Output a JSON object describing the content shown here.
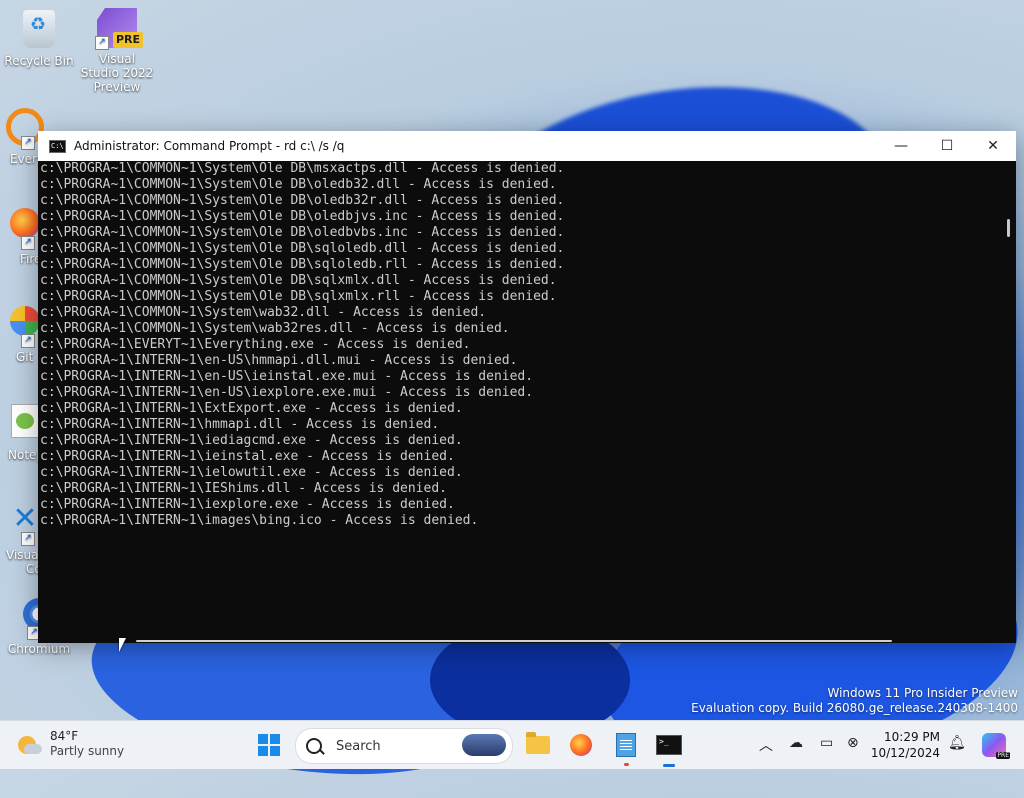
{
  "desktop": {
    "icons": [
      {
        "label": "Recycle Bin"
      },
      {
        "label": "Visual Studio 2022 Preview",
        "badge": "PRE"
      },
      {
        "label": "Every"
      },
      {
        "label": "Fire"
      },
      {
        "label": "Git"
      },
      {
        "label": "Notep"
      },
      {
        "label": "Visual"
      },
      {
        "label": "Co"
      },
      {
        "label": "Chromium"
      }
    ]
  },
  "window": {
    "title": "Administrator: Command Prompt - rd  c:\\ /s /q",
    "controls": {
      "minimize": "—",
      "maximize": "☐",
      "close": "✕"
    },
    "lines": [
      "c:\\PROGRA~1\\COMMON~1\\System\\Ole DB\\msxactps.dll - Access is denied.",
      "c:\\PROGRA~1\\COMMON~1\\System\\Ole DB\\oledb32.dll - Access is denied.",
      "c:\\PROGRA~1\\COMMON~1\\System\\Ole DB\\oledb32r.dll - Access is denied.",
      "c:\\PROGRA~1\\COMMON~1\\System\\Ole DB\\oledbjvs.inc - Access is denied.",
      "c:\\PROGRA~1\\COMMON~1\\System\\Ole DB\\oledbvbs.inc - Access is denied.",
      "c:\\PROGRA~1\\COMMON~1\\System\\Ole DB\\sqloledb.dll - Access is denied.",
      "c:\\PROGRA~1\\COMMON~1\\System\\Ole DB\\sqloledb.rll - Access is denied.",
      "c:\\PROGRA~1\\COMMON~1\\System\\Ole DB\\sqlxmlx.dll - Access is denied.",
      "c:\\PROGRA~1\\COMMON~1\\System\\Ole DB\\sqlxmlx.rll - Access is denied.",
      "c:\\PROGRA~1\\COMMON~1\\System\\wab32.dll - Access is denied.",
      "c:\\PROGRA~1\\COMMON~1\\System\\wab32res.dll - Access is denied.",
      "c:\\PROGRA~1\\EVERYT~1\\Everything.exe - Access is denied.",
      "c:\\PROGRA~1\\INTERN~1\\en-US\\hmmapi.dll.mui - Access is denied.",
      "c:\\PROGRA~1\\INTERN~1\\en-US\\ieinstal.exe.mui - Access is denied.",
      "c:\\PROGRA~1\\INTERN~1\\en-US\\iexplore.exe.mui - Access is denied.",
      "c:\\PROGRA~1\\INTERN~1\\ExtExport.exe - Access is denied.",
      "c:\\PROGRA~1\\INTERN~1\\hmmapi.dll - Access is denied.",
      "c:\\PROGRA~1\\INTERN~1\\iediagcmd.exe - Access is denied.",
      "c:\\PROGRA~1\\INTERN~1\\ieinstal.exe - Access is denied.",
      "c:\\PROGRA~1\\INTERN~1\\ielowutil.exe - Access is denied.",
      "c:\\PROGRA~1\\INTERN~1\\IEShims.dll - Access is denied.",
      "c:\\PROGRA~1\\INTERN~1\\iexplore.exe - Access is denied.",
      "c:\\PROGRA~1\\INTERN~1\\images\\bing.ico - Access is denied."
    ]
  },
  "watermark": {
    "line1": "Windows 11 Pro Insider Preview",
    "line2": "Evaluation copy. Build 26080.ge_release.240308-1400"
  },
  "taskbar": {
    "weather": {
      "temp": "84°F",
      "condition": "Partly sunny"
    },
    "search_placeholder": "Search",
    "clock": {
      "time": "10:29 PM",
      "date": "10/12/2024"
    },
    "tray_icons": [
      "chevron-up-icon",
      "cloud-off-icon",
      "network-icon",
      "volume-muted-icon",
      "notification-bell-icon"
    ]
  },
  "colors": {
    "console_bg": "#0c0c0c",
    "console_fg": "#cccccc",
    "taskbar_bg": "#eef1f5",
    "accent": "#1a6fd8"
  }
}
